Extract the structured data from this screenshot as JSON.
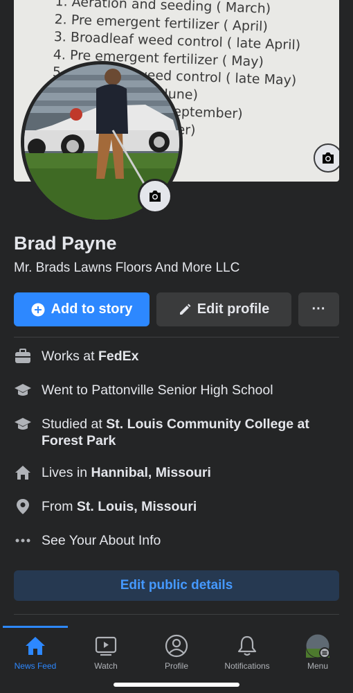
{
  "cover": {
    "lines": [
      "1. Aeration and seeding ( March)",
      "2. Pre emergent fertilizer ( April)",
      "3. Broadleaf weed control ( late April)",
      "4. Pre emergent fertilizer ( May)",
      "5. Broadleaf weed control ( late May)",
      "6. Grub control ( June)",
      "7. Overseeding ( September)",
      "8. Fertilizer ( October)"
    ]
  },
  "profile": {
    "name": "Brad Payne",
    "bio": "Mr. Brads Lawns Floors And More LLC"
  },
  "actions": {
    "add_story": "Add to story",
    "edit_profile": "Edit profile",
    "more": "···"
  },
  "info": [
    {
      "icon": "briefcase-icon",
      "prefix": "Works at ",
      "value": "FedEx"
    },
    {
      "icon": "graduation-cap-icon",
      "prefix": "Went to Pattonville Senior High School",
      "value": ""
    },
    {
      "icon": "graduation-cap-icon",
      "prefix": "Studied at ",
      "value": "St. Louis Community College at Forest Park"
    },
    {
      "icon": "home-icon",
      "prefix": "Lives in ",
      "value": "Hannibal, Missouri"
    },
    {
      "icon": "location-pin-icon",
      "prefix": "From ",
      "value": "St. Louis, Missouri"
    },
    {
      "icon": "more-dots-icon",
      "prefix": "See Your About Info",
      "value": ""
    }
  ],
  "edit_public": "Edit public details",
  "tabs": [
    {
      "label": "News Feed",
      "icon": "home-icon",
      "active": true
    },
    {
      "label": "Watch",
      "icon": "watch-icon",
      "active": false
    },
    {
      "label": "Profile",
      "icon": "profile-icon",
      "active": false
    },
    {
      "label": "Notifications",
      "icon": "bell-icon",
      "active": false
    },
    {
      "label": "Menu",
      "icon": "avatar-icon",
      "active": false
    }
  ],
  "colors": {
    "background": "#242526",
    "accent": "#2d88ff",
    "secondary_button": "#3a3b3c",
    "text": "#e4e6eb",
    "muted": "#b0b3b8"
  }
}
